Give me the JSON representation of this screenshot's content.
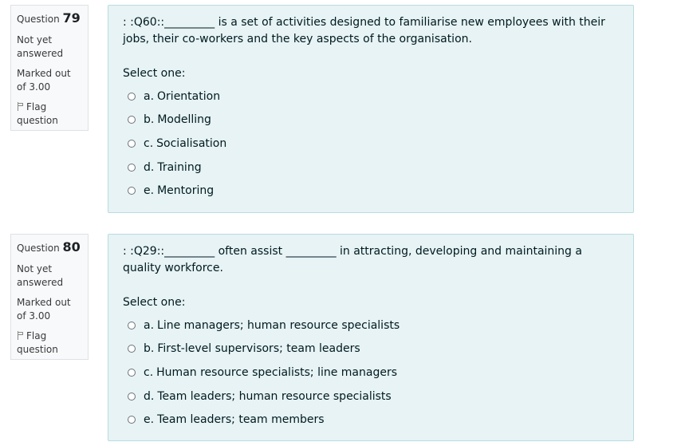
{
  "questions": [
    {
      "label": "Question",
      "number": "79",
      "state": "Not yet answered",
      "grade": "Marked out of 3.00",
      "flag": "Flag question",
      "text": ": :Q60::_________ is a set of activities designed to familiarise new employees with their jobs, their co-workers and the key aspects of the organisation.",
      "prompt": "Select one:",
      "answers": [
        {
          "letter": "a.",
          "text": "Orientation"
        },
        {
          "letter": "b.",
          "text": "Modelling"
        },
        {
          "letter": "c.",
          "text": "Socialisation"
        },
        {
          "letter": "d.",
          "text": "Training"
        },
        {
          "letter": "e.",
          "text": "Mentoring"
        }
      ]
    },
    {
      "label": "Question",
      "number": "80",
      "state": "Not yet answered",
      "grade": "Marked out of 3.00",
      "flag": "Flag question",
      "text": ": :Q29::_________ often assist _________ in attracting, developing and maintaining a quality workforce.",
      "prompt": "Select one:",
      "answers": [
        {
          "letter": "a.",
          "text": "Line managers; human resource specialists"
        },
        {
          "letter": "b.",
          "text": "First-level supervisors; team leaders"
        },
        {
          "letter": "c.",
          "text": "Human resource specialists; line managers"
        },
        {
          "letter": "d.",
          "text": "Team leaders; human resource specialists"
        },
        {
          "letter": "e.",
          "text": "Team leaders; team members"
        }
      ]
    }
  ]
}
